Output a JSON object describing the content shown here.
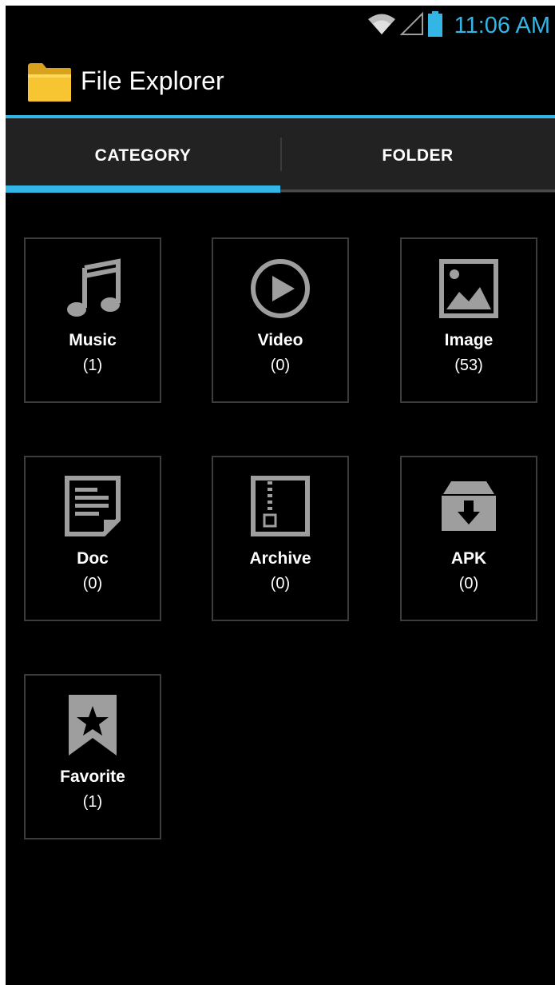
{
  "status_bar": {
    "time": "11:06 AM",
    "icons": [
      "wifi-icon",
      "signal-icon",
      "battery-icon"
    ],
    "accent_color": "#33b5e5"
  },
  "action_bar": {
    "title": "File Explorer",
    "icon": "folder-icon"
  },
  "tabs": [
    {
      "label": "CATEGORY",
      "selected": true
    },
    {
      "label": "FOLDER",
      "selected": false
    }
  ],
  "categories": [
    {
      "label": "Music",
      "count": "(1)",
      "icon": "music-note-icon"
    },
    {
      "label": "Video",
      "count": "(0)",
      "icon": "play-circle-icon"
    },
    {
      "label": "Image",
      "count": "(53)",
      "icon": "image-icon"
    },
    {
      "label": "Doc",
      "count": "(0)",
      "icon": "document-icon"
    },
    {
      "label": "Archive",
      "count": "(0)",
      "icon": "archive-zip-icon"
    },
    {
      "label": "APK",
      "count": "(0)",
      "icon": "apk-download-icon"
    },
    {
      "label": "Favorite",
      "count": "(1)",
      "icon": "favorite-star-icon"
    }
  ]
}
